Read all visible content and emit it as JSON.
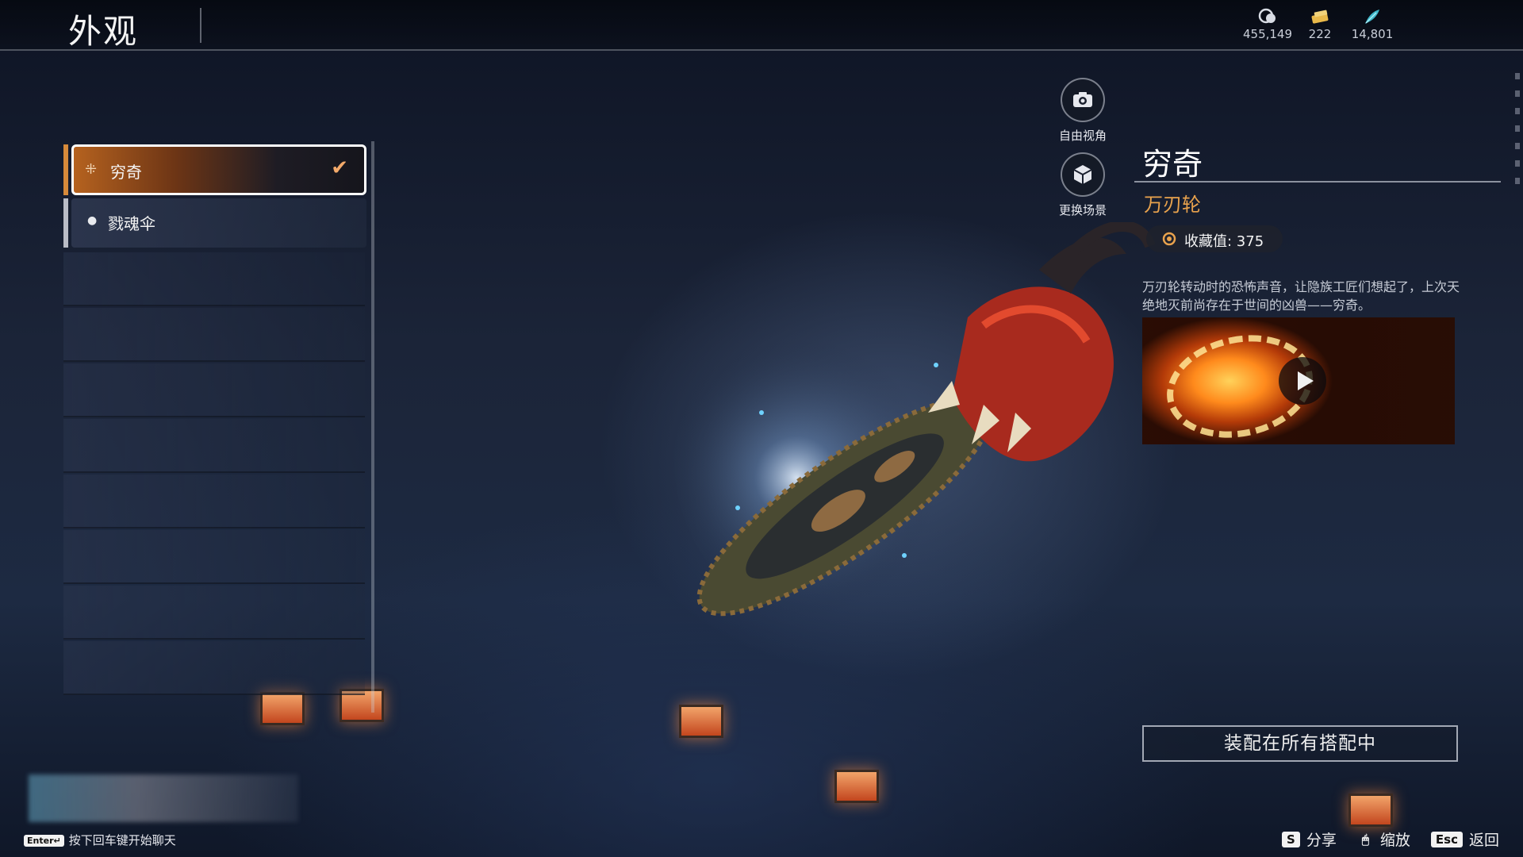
{
  "header": {
    "title": "外观"
  },
  "currencies": [
    {
      "icon": "coin-stack-icon",
      "value": "455,149"
    },
    {
      "icon": "ticket-icon",
      "value": "222"
    },
    {
      "icon": "feather-icon",
      "value": "14,801"
    }
  ],
  "list": {
    "items": [
      {
        "label": "穷奇",
        "icon": "cross-pattern-icon",
        "selected": true
      },
      {
        "label": "戮魂伞",
        "icon": "droplet-icon",
        "selected": false
      }
    ]
  },
  "side_buttons": {
    "free_view": "自由视角",
    "change_scene": "更换场景"
  },
  "detail": {
    "name": "穷奇",
    "subtitle": "万刃轮",
    "collection_label": "收藏值: 375",
    "description": "万刃轮转动时的恐怖声音，让隐族工匠们想起了，上次天绝地灭前尚存在于世间的凶兽——穷奇。",
    "equip_label": "装配在所有搭配中"
  },
  "chat": {
    "key": "Enter↵",
    "hint": "按下回车键开始聊天"
  },
  "bottom_hints": [
    {
      "key": "S",
      "label": "分享"
    },
    {
      "key": "🖱",
      "label": "缩放"
    },
    {
      "key": "Esc",
      "label": "返回"
    }
  ],
  "colors": {
    "accent_orange": "#e8a24d",
    "selected_gradient_start": "#b5621f"
  }
}
